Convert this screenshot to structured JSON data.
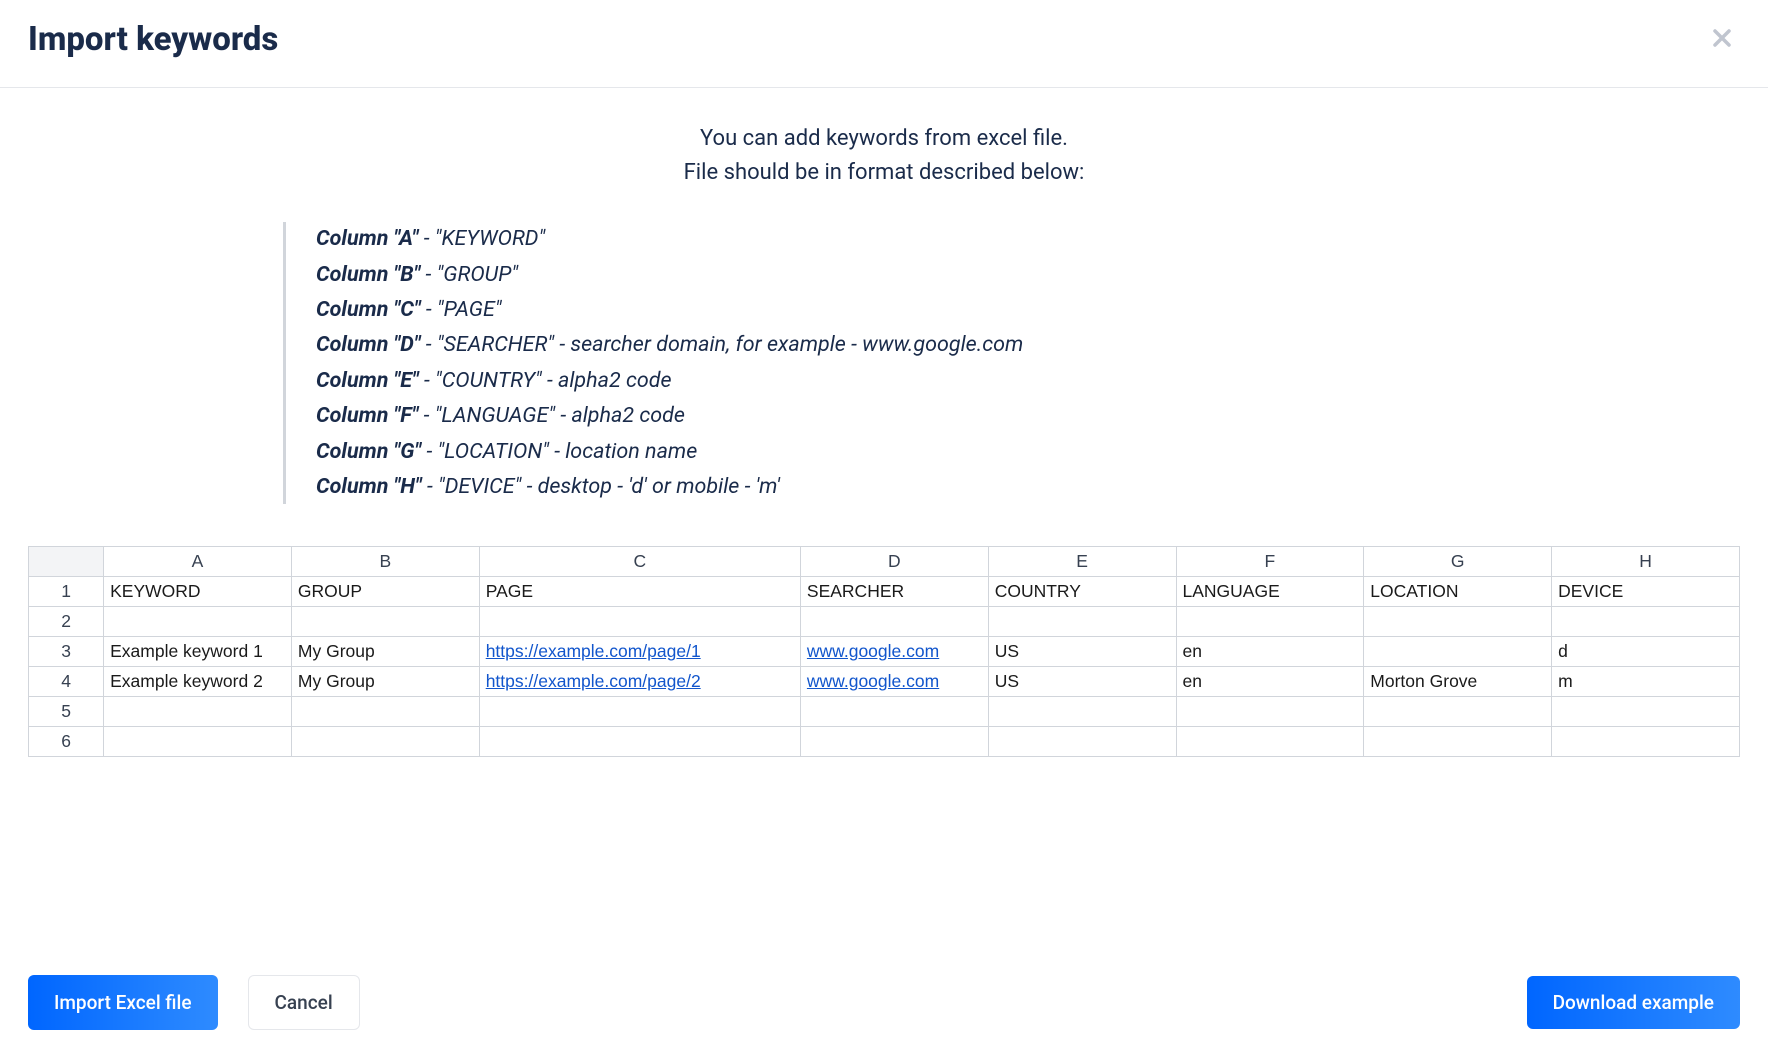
{
  "modal": {
    "title": "Import keywords"
  },
  "intro": {
    "line1": "You can add keywords from excel file.",
    "line2": "File should be in format described below:"
  },
  "columns": [
    {
      "label": "Column \"A\"",
      "desc": " - \"KEYWORD\""
    },
    {
      "label": "Column \"B\"",
      "desc": " - \"GROUP\""
    },
    {
      "label": "Column \"C\"",
      "desc": " - \"PAGE\""
    },
    {
      "label": "Column \"D\"",
      "desc": " - \"SEARCHER\" - searcher domain, for example - www.google.com"
    },
    {
      "label": "Column \"E\"",
      "desc": " - \"COUNTRY\" - alpha2 code"
    },
    {
      "label": "Column \"F\"",
      "desc": " - \"LANGUAGE\" - alpha2 code"
    },
    {
      "label": "Column \"G\"",
      "desc": " - \"LOCATION\" - location name"
    },
    {
      "label": "Column \"H\"",
      "desc": " - \"DEVICE\" - desktop - 'd' or mobile - 'm'"
    }
  ],
  "sheet": {
    "colHeaders": [
      "A",
      "B",
      "C",
      "D",
      "E",
      "F",
      "G",
      "H"
    ],
    "rowNums": [
      "1",
      "2",
      "3",
      "4",
      "5",
      "6"
    ],
    "rows": [
      [
        "KEYWORD",
        "GROUP",
        "PAGE",
        "SEARCHER",
        "COUNTRY",
        "LANGUAGE",
        "LOCATION",
        "DEVICE"
      ],
      [
        "",
        "",
        "",
        "",
        "",
        "",
        "",
        ""
      ],
      [
        "Example keyword 1",
        "My Group",
        "https://example.com/page/1",
        "www.google.com",
        "US",
        "en",
        "",
        "d"
      ],
      [
        "Example keyword 2",
        "My Group",
        "https://example.com/page/2",
        "www.google.com",
        "US",
        "en",
        "Morton Grove",
        "m"
      ],
      [
        "",
        "",
        "",
        "",
        "",
        "",
        "",
        ""
      ],
      [
        "",
        "",
        "",
        "",
        "",
        "",
        "",
        ""
      ]
    ]
  },
  "buttons": {
    "import": "Import Excel file",
    "cancel": "Cancel",
    "download": "Download example"
  }
}
